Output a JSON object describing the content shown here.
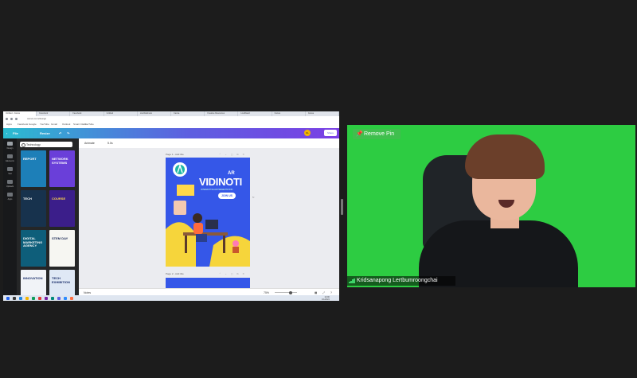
{
  "browser": {
    "tabs": [
      "Untitled - Canva",
      "Facebook",
      "Facebook",
      "Untitled",
      "LineWebinars",
      "Canva",
      "Creative Resources",
      "LineBoard",
      "Canva",
      "Canva"
    ],
    "url": "canva.com/design",
    "bookmarks": [
      "Apps",
      "Facebook",
      "Google",
      "YouTube",
      "Gmail",
      "Outlook",
      "Smart Class",
      "YouTube"
    ]
  },
  "canva": {
    "topbar": {
      "back": "‹",
      "file": "File",
      "resize": "Resize",
      "avatar": "KL",
      "share": "Share"
    },
    "rail": [
      "Design",
      "Elements",
      "Text",
      "Uploads",
      "Apps"
    ],
    "search_value": "Technology",
    "templates": [
      {
        "label": "REPORT",
        "bg": "#1d7fb8",
        "fg": "#ffffff"
      },
      {
        "label": "NETWORK SYSTEMS",
        "bg": "#6a3fd9",
        "fg": "#ffffff"
      },
      {
        "label": "TECH",
        "bg": "#17324d",
        "fg": "#ffffff"
      },
      {
        "label": "COURSE",
        "bg": "#3b1e8a",
        "fg": "#ffd84a"
      },
      {
        "label": "DIGITAL MARKETING AGENCY",
        "bg": "#0e5e7a",
        "fg": "#ffffff"
      },
      {
        "label": "STEM DAY",
        "bg": "#f6f6f2",
        "fg": "#1c2a55"
      },
      {
        "label": "INNOVATION",
        "bg": "#f1f3f7",
        "fg": "#1b2f6b"
      },
      {
        "label": "TECH EXHIBITION",
        "bg": "#dfe8f5",
        "fg": "#1b2f6b"
      }
    ],
    "toolbar": {
      "animate": "Animate",
      "duration": "5.0s"
    },
    "page1_label": "Page 1 - Add title",
    "page2_label": "Page 2 - Add title",
    "poster": {
      "pre": "AR",
      "title": "VIDINOTI",
      "subtitle": "INTERACTIVE AR PRESENTATION",
      "button": "JOIN US"
    },
    "status": {
      "notes": "Notes",
      "zoom": "75%"
    }
  },
  "taskbar": {
    "time": "12:00",
    "date": "1/1/2024"
  },
  "webcam": {
    "remove_pin": "Remove Pin",
    "participant_name": "Kridsanapong Lertbumroongchai"
  },
  "colors": {
    "screen_green": "#2dcc42",
    "canva_accent": "#5d5fe0",
    "poster_blue": "#3557e8"
  }
}
